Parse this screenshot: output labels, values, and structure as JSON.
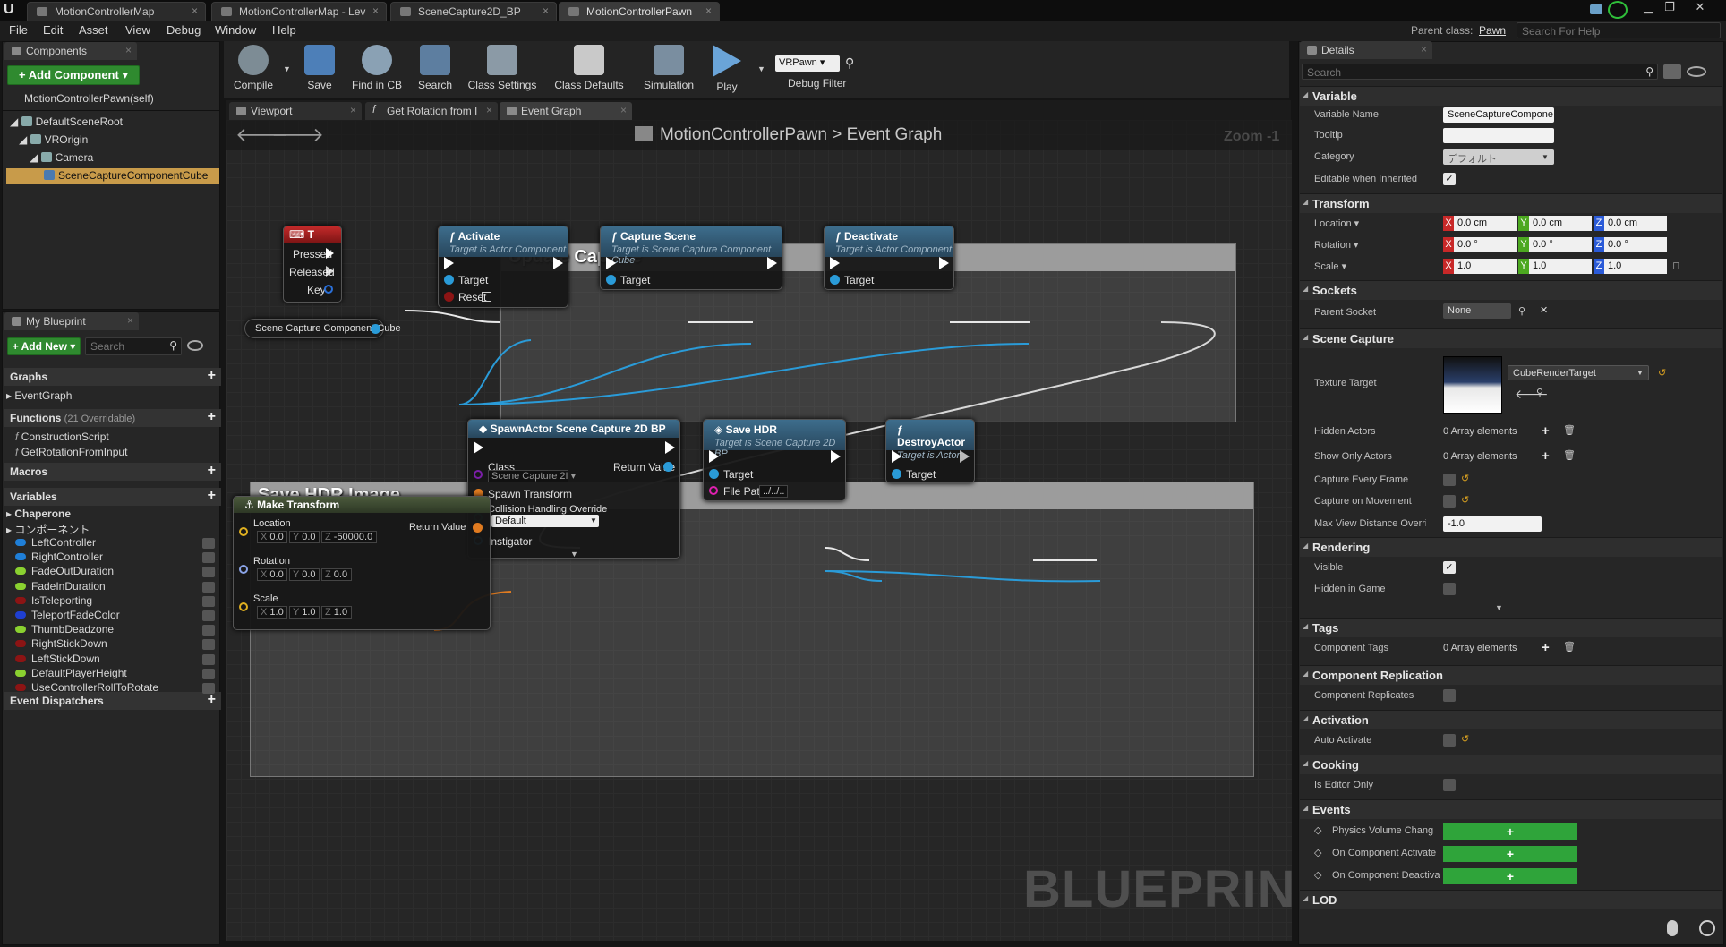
{
  "window": {
    "tabs": [
      "MotionControllerMap",
      "MotionControllerMap - Lev",
      "SceneCapture2D_BP",
      "MotionControllerPawn"
    ],
    "parent_class_label": "Parent class:",
    "parent_class_value": "Pawn",
    "help_placeholder": "Search For Help"
  },
  "menu": [
    "File",
    "Edit",
    "Asset",
    "View",
    "Debug",
    "Window",
    "Help"
  ],
  "components": {
    "tab": "Components",
    "add_button": "+ Add Component ▾",
    "self_label": "MotionControllerPawn(self)",
    "tree": [
      "DefaultSceneRoot",
      "VROrigin",
      "Camera",
      "SceneCaptureComponentCube"
    ]
  },
  "toolbar": {
    "buttons": [
      "Compile",
      "Save",
      "Find in CB",
      "Search",
      "Class Settings",
      "Class Defaults",
      "Simulation",
      "Play"
    ],
    "debug_object": "VRPawn ▾",
    "debug_filter": "Debug Filter"
  },
  "editor_tabs": [
    "Viewport",
    "Get Rotation from I",
    "Event Graph"
  ],
  "graph": {
    "breadcrumb_root": "MotionControllerPawn",
    "breadcrumb_sep": ">",
    "breadcrumb_leaf": "Event Graph",
    "zoom": "Zoom -1",
    "watermark": "BLUEPRINT",
    "comments": [
      "Update Capture",
      "Save HDR Image"
    ],
    "key_node": {
      "title": "T",
      "pins": [
        "Pressed",
        "Released",
        "Key"
      ]
    },
    "var_node": "Scene Capture Component Cube",
    "activate": {
      "title": "Activate",
      "sub": "Target is Actor Component",
      "pins": [
        "Target",
        "Reset"
      ]
    },
    "capture": {
      "title": "Capture Scene",
      "sub": "Target is Scene Capture Component Cube",
      "pins": [
        "Target"
      ]
    },
    "deactivate": {
      "title": "Deactivate",
      "sub": "Target is Actor Component",
      "pins": [
        "Target"
      ]
    },
    "spawn": {
      "title": "SpawnActor Scene Capture 2D BP",
      "pins": [
        "Class",
        "Return Value",
        "Spawn Transform",
        "Collision Handling Override",
        "Instigator"
      ],
      "class_value": "Scene Capture 2I ▾",
      "collision_value": "Default"
    },
    "save_hdr": {
      "title": "Save HDR",
      "sub": "Target is Scene Capture 2D BP",
      "pins": [
        "Target",
        "File Path"
      ],
      "file_path": "../../.."
    },
    "destroy": {
      "title": "DestroyActor",
      "sub": "Target is Actor",
      "pins": [
        "Target"
      ]
    },
    "make_transform": {
      "title": "Make Transform",
      "pins": [
        "Location",
        "Rotation",
        "Scale",
        "Return Value"
      ],
      "location": [
        "0.0",
        "0.0",
        "-50000.0"
      ],
      "rotation": [
        "0.0",
        "0.0",
        "0.0"
      ],
      "scale": [
        "1.0",
        "1.0",
        "1.0"
      ]
    }
  },
  "my_blueprint": {
    "tab": "My Blueprint",
    "add_new": "+ Add New ▾",
    "search_placeholder": "Search",
    "graphs_hdr": "Graphs",
    "graphs": [
      "EventGraph"
    ],
    "functions_hdr": "Functions",
    "functions_note": "(21 Overridable)",
    "functions": [
      "ConstructionScript",
      "GetRotationFromInput"
    ],
    "macros_hdr": "Macros",
    "variables_hdr": "Variables",
    "var_groups": [
      "Chaperone",
      "コンポーネント"
    ],
    "variables": [
      {
        "name": "LeftController",
        "color": "#1f7fd8"
      },
      {
        "name": "RightController",
        "color": "#1f7fd8"
      },
      {
        "name": "FadeOutDuration",
        "color": "#8ad130"
      },
      {
        "name": "FadeInDuration",
        "color": "#8ad130"
      },
      {
        "name": "IsTeleporting",
        "color": "#8c1414"
      },
      {
        "name": "TeleportFadeColor",
        "color": "#1f3fd0"
      },
      {
        "name": "ThumbDeadzone",
        "color": "#8ad130"
      },
      {
        "name": "RightStickDown",
        "color": "#8c1414"
      },
      {
        "name": "LeftStickDown",
        "color": "#8c1414"
      },
      {
        "name": "DefaultPlayerHeight",
        "color": "#8ad130"
      },
      {
        "name": "UseControllerRollToRotate",
        "color": "#8c1414"
      }
    ],
    "dispatchers_hdr": "Event Dispatchers"
  },
  "details": {
    "tab": "Details",
    "search_placeholder": "Search",
    "sections": [
      "Variable",
      "Transform",
      "Sockets",
      "Scene Capture",
      "Rendering",
      "Tags",
      "Component Replication",
      "Activation",
      "Cooking",
      "Events",
      "LOD"
    ],
    "variable_name_label": "Variable Name",
    "variable_name_value": "SceneCaptureCompone",
    "tooltip_label": "Tooltip",
    "category_label": "Category",
    "category_value": "デフォルト",
    "editable_label": "Editable when Inherited",
    "location_label": "Location ▾",
    "rotation_label": "Rotation ▾",
    "scale_label": "Scale ▾",
    "location": [
      "0.0 cm",
      "0.0 cm",
      "0.0 cm"
    ],
    "rotation": [
      "0.0 °",
      "0.0 °",
      "0.0 °"
    ],
    "scale": [
      "1.0",
      "1.0",
      "1.0"
    ],
    "parent_socket_label": "Parent Socket",
    "parent_socket_value": "None",
    "texture_target_label": "Texture Target",
    "texture_target_value": "CubeRenderTarget",
    "hidden_actors_label": "Hidden Actors",
    "show_only_label": "Show Only Actors",
    "array_elements": "0 Array elements",
    "capture_every_frame_label": "Capture Every Frame",
    "capture_on_movement_label": "Capture on Movement",
    "max_view_label": "Max View Distance Overrid",
    "max_view_value": "-1.0",
    "visible_label": "Visible",
    "hidden_in_game_label": "Hidden in Game",
    "component_tags_label": "Component Tags",
    "component_replicates_label": "Component Replicates",
    "auto_activate_label": "Auto Activate",
    "is_editor_only_label": "Is Editor Only",
    "events": [
      "Physics Volume Chang",
      "On Component Activate",
      "On Component Deactiva"
    ]
  }
}
